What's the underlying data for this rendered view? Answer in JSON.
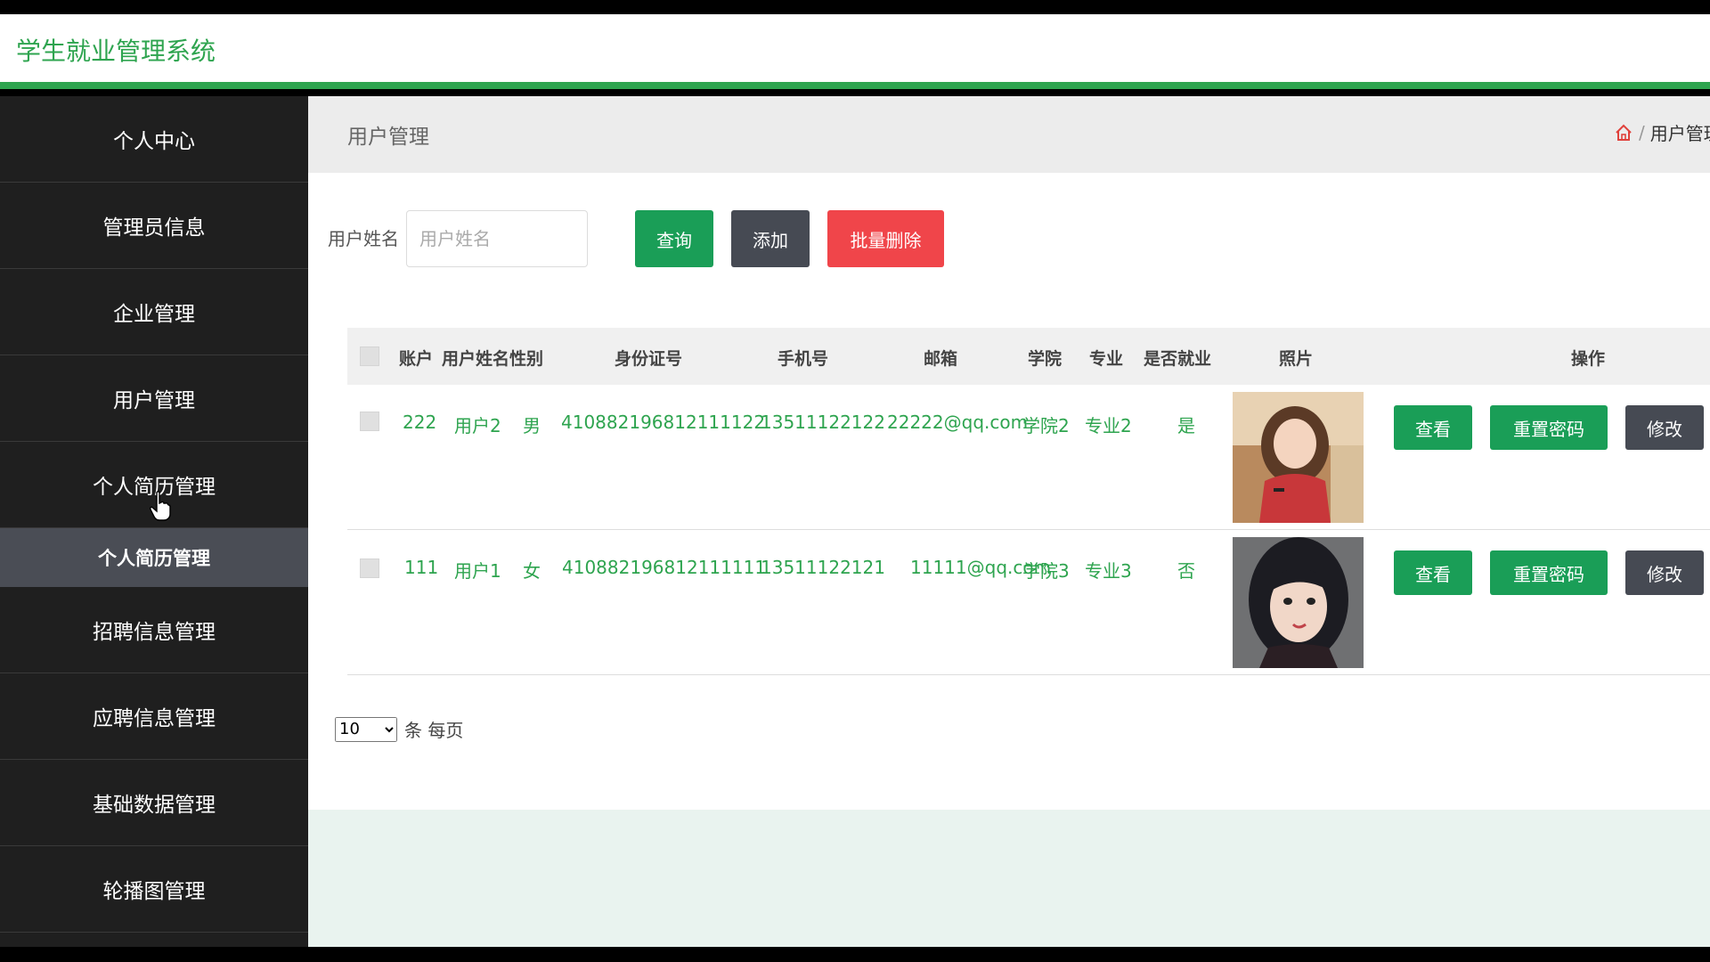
{
  "app": {
    "title": "学生就业管理系统"
  },
  "sidebar": {
    "items": [
      {
        "label": "个人中心"
      },
      {
        "label": "管理员信息"
      },
      {
        "label": "企业管理"
      },
      {
        "label": "用户管理"
      },
      {
        "label": "个人简历管理"
      }
    ],
    "submenu_label": "个人简历管理",
    "items_after": [
      {
        "label": "招聘信息管理"
      },
      {
        "label": "应聘信息管理"
      },
      {
        "label": "基础数据管理"
      },
      {
        "label": "轮播图管理"
      }
    ]
  },
  "breadcrumb": {
    "page_title": "用户管理",
    "separator": "/",
    "current": "用户管理"
  },
  "search": {
    "label": "用户姓名",
    "placeholder": "用户姓名",
    "query_label": "查询",
    "add_label": "添加",
    "batch_delete_label": "批量删除"
  },
  "table": {
    "headers": {
      "account": "账户",
      "name": "用户姓名",
      "gender": "性别",
      "id_number": "身份证号",
      "phone": "手机号",
      "email": "邮箱",
      "college": "学院",
      "major": "专业",
      "employed": "是否就业",
      "photo": "照片",
      "actions": "操作"
    },
    "rows": [
      {
        "account": "222",
        "name": "用户2",
        "gender": "男",
        "id_number": "410882196812111122",
        "phone": "13511122122",
        "email": "22222@qq.com",
        "college": "学院2",
        "major": "专业2",
        "employed": "是"
      },
      {
        "account": "111",
        "name": "用户1",
        "gender": "女",
        "id_number": "410882196812111111",
        "phone": "13511122121",
        "email": "11111@qq.com",
        "college": "学院3",
        "major": "专业3",
        "employed": "否"
      }
    ],
    "row_actions": {
      "view": "查看",
      "reset": "重置密码",
      "edit": "修改"
    }
  },
  "pager": {
    "page_size": "10",
    "suffix": "条 每页"
  },
  "colors": {
    "brand_green": "#2ea44f",
    "button_green": "#1a9e57",
    "button_dark": "#464a53",
    "button_red": "#f0454a",
    "sidebar_bg": "#1f1f1f"
  }
}
